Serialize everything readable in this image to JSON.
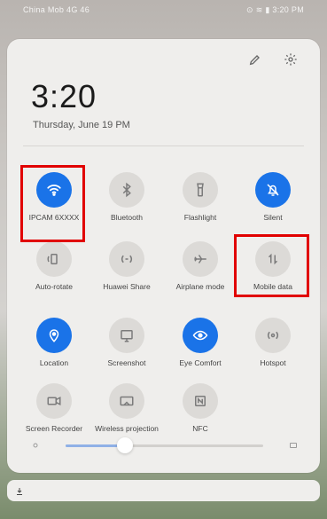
{
  "status_bar": {
    "left_text": "China Mob 4G 46",
    "right_text": "⊙ ≋ ▮ 3:20 PM"
  },
  "quick_panel": {
    "clock": "3:20",
    "date": "Thursday, June 19 PM",
    "icons": {
      "edit": "pencil-icon",
      "settings": "gear-icon"
    },
    "tiles": [
      {
        "id": "wifi",
        "label": "IPCAM 6XXXX",
        "on": true,
        "icon": "wifi-icon"
      },
      {
        "id": "bluetooth",
        "label": "Bluetooth",
        "on": false,
        "icon": "bluetooth-icon"
      },
      {
        "id": "flashlight",
        "label": "Flashlight",
        "on": false,
        "icon": "flashlight-icon"
      },
      {
        "id": "silent",
        "label": "Silent",
        "on": true,
        "icon": "bell-off-icon"
      },
      {
        "id": "autorotate",
        "label": "Auto-rotate",
        "on": false,
        "icon": "rotate-icon"
      },
      {
        "id": "huaweishare",
        "label": "Huawei Share",
        "on": false,
        "icon": "share-icon"
      },
      {
        "id": "airplane",
        "label": "Airplane mode",
        "on": false,
        "icon": "airplane-icon"
      },
      {
        "id": "mobiledata",
        "label": "Mobile data",
        "on": false,
        "icon": "mobile-data-icon"
      },
      {
        "id": "location",
        "label": "Location",
        "on": true,
        "icon": "location-icon"
      },
      {
        "id": "screenshot",
        "label": "Screenshot",
        "on": false,
        "icon": "screenshot-icon"
      },
      {
        "id": "eyecomfort",
        "label": "Eye Comfort",
        "on": true,
        "icon": "eye-icon"
      },
      {
        "id": "hotspot",
        "label": "Hotspot",
        "on": false,
        "icon": "hotspot-icon"
      },
      {
        "id": "screenrecorder",
        "label": "Screen Recorder",
        "on": false,
        "icon": "video-icon"
      },
      {
        "id": "wirelessprojection",
        "label": "Wireless projection",
        "on": false,
        "icon": "cast-icon"
      },
      {
        "id": "nfc",
        "label": "NFC",
        "on": false,
        "icon": "nfc-icon"
      }
    ],
    "brightness": {
      "level": 0.3
    }
  },
  "colors": {
    "accent": "#1a73e8",
    "highlight": "#e10000"
  }
}
